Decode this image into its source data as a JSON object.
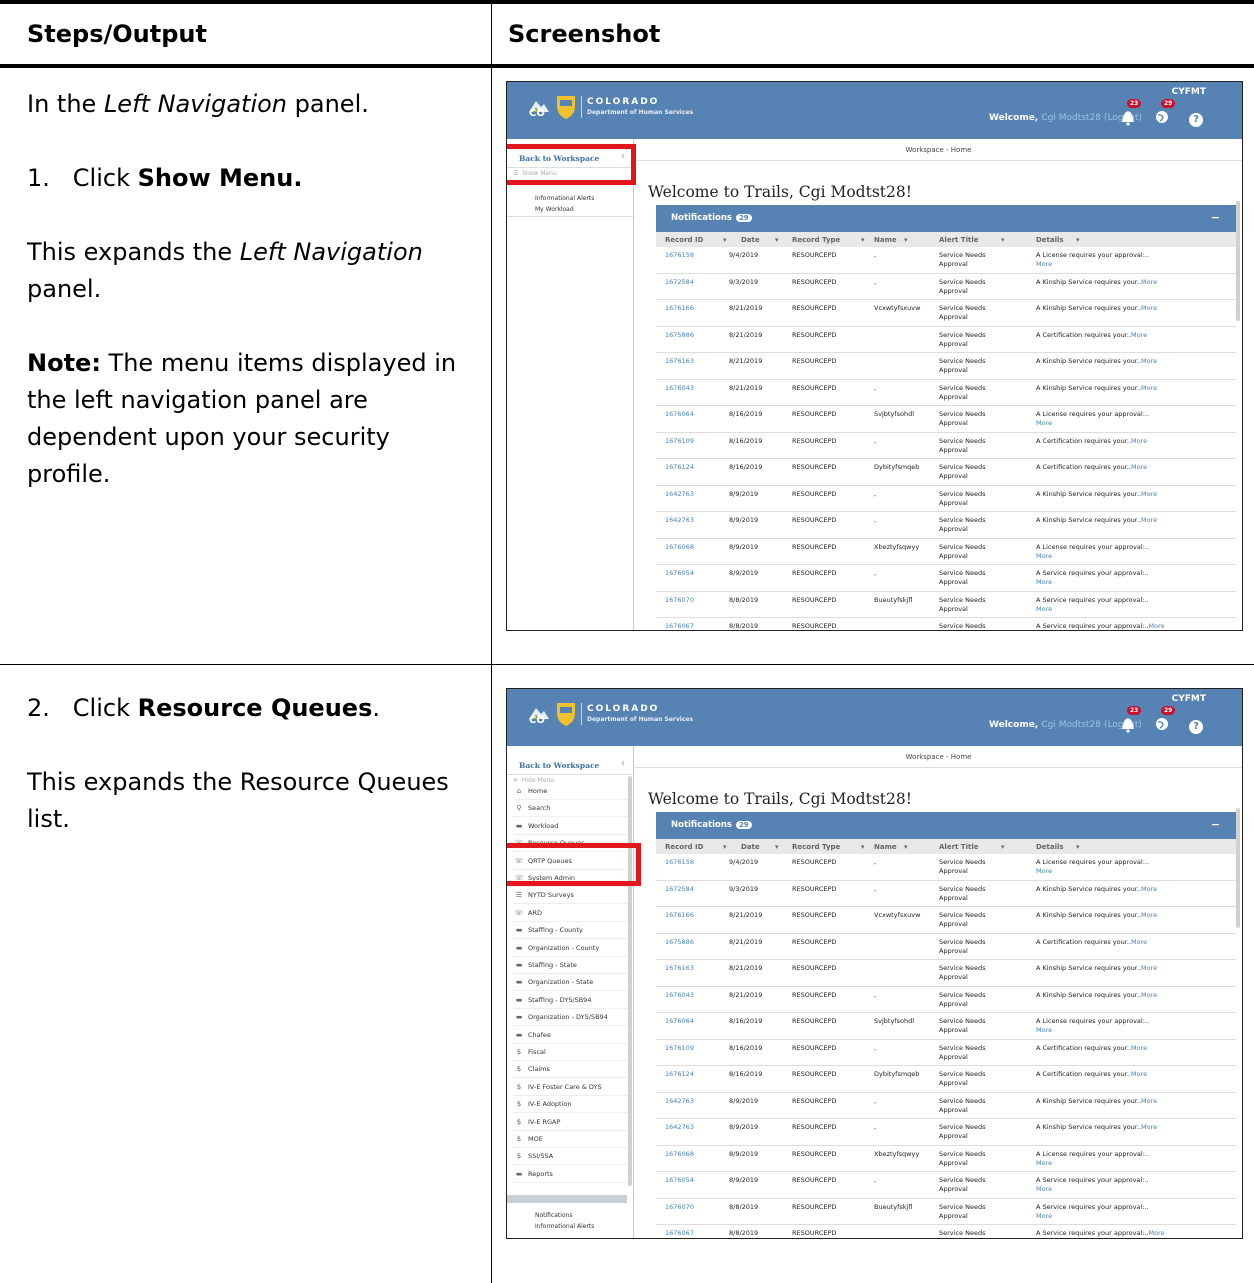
{
  "table": {
    "col_steps": "Steps/Output",
    "col_shot": "Screenshot"
  },
  "row1": {
    "intro_a": "In the ",
    "intro_em": "Left Navigation",
    "intro_b": " panel.",
    "step_num": "1.",
    "step_a": "Click ",
    "step_bold": "Show Menu.",
    "expand_a": "This expands the ",
    "expand_em": "Left Navigation",
    "expand_b": " panel.",
    "note_bold": "Note:",
    "note_text": " The menu items displayed in the left navigation panel are dependent upon your security profile."
  },
  "row2": {
    "step_num": "2.",
    "step_a": "Click ",
    "step_bold": "Resource Queues",
    "step_b": ".",
    "expand": "This expands the Resource Queues list."
  },
  "app": {
    "logo_text": "CO",
    "brand_line1": "COLORADO",
    "brand_line2": "Department of Human Services",
    "env": "CYFMT",
    "welcome": "Welcome,",
    "user": "Cgi Modtst28",
    "logout_open": "(",
    "logout": "Logout",
    "logout_close": ")",
    "bell_badge": "23",
    "globe_badge": "29",
    "help": "?",
    "back_link": "Back to Workspace",
    "show_menu": "Show Menu",
    "hide_menu": "Hide Menu",
    "side_links": [
      "Notifications",
      "Informational Alerts",
      "My Workload"
    ],
    "breadcrumb": "Workspace - Home",
    "welcome_heading": "Welcome to Trails, Cgi Modtst28!",
    "notifications_label": "Notifications",
    "notifications_count": "29",
    "columns": [
      "Record ID",
      "Date",
      "Record Type",
      "Name",
      "Alert Title",
      "Details"
    ],
    "more": "More",
    "rows": [
      {
        "id": "1676158",
        "date": "9/4/2019",
        "type": "RESOURCEPD",
        "name": ",",
        "alert1": "Service Needs",
        "alert2": "Approval",
        "details": "A License requires your approval:..",
        "more_wrap": true
      },
      {
        "id": "1672584",
        "date": "9/3/2019",
        "type": "RESOURCEPD",
        "name": ",",
        "alert1": "Service Needs",
        "alert2": "Approval",
        "details": "A Kinship Service requires your..",
        "more_wrap": false
      },
      {
        "id": "1676166",
        "date": "8/21/2019",
        "type": "RESOURCEPD",
        "name": "Vcxwtyfsxuvw",
        "alert1": "Service Needs",
        "alert2": "Approval",
        "details": "A Kinship Service requires your..",
        "more_wrap": false
      },
      {
        "id": "1675886",
        "date": "8/21/2019",
        "type": "RESOURCEPD",
        "name": "",
        "alert1": "Service Needs",
        "alert2": "Approval",
        "details": "A Certification requires your..",
        "more_wrap": false
      },
      {
        "id": "1676163",
        "date": "8/21/2019",
        "type": "RESOURCEPD",
        "name": "",
        "alert1": "Service Needs",
        "alert2": "Approval",
        "details": "A Kinship Service requires your..",
        "more_wrap": false
      },
      {
        "id": "1676043",
        "date": "8/21/2019",
        "type": "RESOURCEPD",
        "name": ",",
        "alert1": "Service Needs",
        "alert2": "Approval",
        "details": "A Kinship Service requires your..",
        "more_wrap": false
      },
      {
        "id": "1676064",
        "date": "8/16/2019",
        "type": "RESOURCEPD",
        "name": "Svjbtyfsohdl",
        "alert1": "Service Needs",
        "alert2": "Approval",
        "details": "A License requires your approval:..",
        "more_wrap": true
      },
      {
        "id": "1676109",
        "date": "8/16/2019",
        "type": "RESOURCEPD",
        "name": ",",
        "alert1": "Service Needs",
        "alert2": "Approval",
        "details": "A Certification requires your..",
        "more_wrap": false
      },
      {
        "id": "1676124",
        "date": "8/16/2019",
        "type": "RESOURCEPD",
        "name": "Dybityfsmqeb",
        "alert1": "Service Needs",
        "alert2": "Approval",
        "details": "A Certification requires your..",
        "more_wrap": false
      },
      {
        "id": "1642763",
        "date": "8/9/2019",
        "type": "RESOURCEPD",
        "name": ",",
        "alert1": "Service Needs",
        "alert2": "Approval",
        "details": "A Kinship Service requires your..",
        "more_wrap": false
      },
      {
        "id": "1642763",
        "date": "8/9/2019",
        "type": "RESOURCEPD",
        "name": ",",
        "alert1": "Service Needs",
        "alert2": "Approval",
        "details": "A Kinship Service requires your..",
        "more_wrap": false
      },
      {
        "id": "1676068",
        "date": "8/9/2019",
        "type": "RESOURCEPD",
        "name": "Xbeztyfsqwyy",
        "alert1": "Service Needs",
        "alert2": "Approval",
        "details": "A License requires your approval:..",
        "more_wrap": true
      },
      {
        "id": "1676054",
        "date": "8/9/2019",
        "type": "RESOURCEPD",
        "name": ",",
        "alert1": "Service Needs",
        "alert2": "Approval",
        "details": "A Service requires your approval:..",
        "more_wrap": true
      },
      {
        "id": "1676070",
        "date": "8/8/2019",
        "type": "RESOURCEPD",
        "name": "Bueutyfskjfl",
        "alert1": "Service Needs",
        "alert2": "Approval",
        "details": "A Service requires your approval:..",
        "more_wrap": true
      },
      {
        "id": "1676067",
        "date": "8/8/2019",
        "type": "RESOURCEPD",
        "name": "",
        "alert1": "Service Needs",
        "alert2": "",
        "details": "A Service requires your approval:..",
        "more_wrap": false
      }
    ],
    "menu_items": [
      {
        "icon": "home-icon",
        "glyph": "⌂",
        "label": "Home"
      },
      {
        "icon": "search-icon",
        "glyph": "⚲",
        "label": "Search"
      },
      {
        "icon": "briefcase-icon",
        "glyph": "▬",
        "label": "Workload"
      },
      {
        "icon": "phone-icon",
        "glyph": "☏",
        "label": "Resource Queues"
      },
      {
        "icon": "phone-icon",
        "glyph": "☏",
        "label": "QRTP Queues"
      },
      {
        "icon": "phone-icon",
        "glyph": "☏",
        "label": "System Admin"
      },
      {
        "icon": "list-icon",
        "glyph": "☰",
        "label": "NYTD Surveys"
      },
      {
        "icon": "phone-icon",
        "glyph": "☏",
        "label": "ARD"
      },
      {
        "icon": "briefcase-icon",
        "glyph": "▬",
        "label": "Staffing - County"
      },
      {
        "icon": "briefcase-icon",
        "glyph": "▬",
        "label": "Organization - County"
      },
      {
        "icon": "briefcase-icon",
        "glyph": "▬",
        "label": "Staffing - State"
      },
      {
        "icon": "briefcase-icon",
        "glyph": "▬",
        "label": "Organization - State"
      },
      {
        "icon": "briefcase-icon",
        "glyph": "▬",
        "label": "Staffing - DYS/SB94"
      },
      {
        "icon": "briefcase-icon",
        "glyph": "▬",
        "label": "Organization - DYS/SB94"
      },
      {
        "icon": "briefcase-icon",
        "glyph": "▬",
        "label": "Chafee"
      },
      {
        "icon": "dollar-icon",
        "glyph": "$",
        "label": "Fiscal"
      },
      {
        "icon": "dollar-icon",
        "glyph": "$",
        "label": "Claims"
      },
      {
        "icon": "dollar-icon",
        "glyph": "$",
        "label": "IV-E Foster Care & DYS"
      },
      {
        "icon": "dollar-icon",
        "glyph": "$",
        "label": "IV-E Adoption"
      },
      {
        "icon": "dollar-icon",
        "glyph": "$",
        "label": "IV-E RGAP"
      },
      {
        "icon": "dollar-icon",
        "glyph": "$",
        "label": "MOE"
      },
      {
        "icon": "dollar-icon",
        "glyph": "$",
        "label": "SSI/SSA"
      },
      {
        "icon": "briefcase-icon",
        "glyph": "▬",
        "label": "Reports"
      }
    ],
    "side_links_2": [
      "Notifications",
      "Informational Alerts"
    ]
  },
  "colors": {
    "header_blue": "#5683b3",
    "highlight_red": "#e3161b",
    "link_blue": "#4a7fb8"
  }
}
